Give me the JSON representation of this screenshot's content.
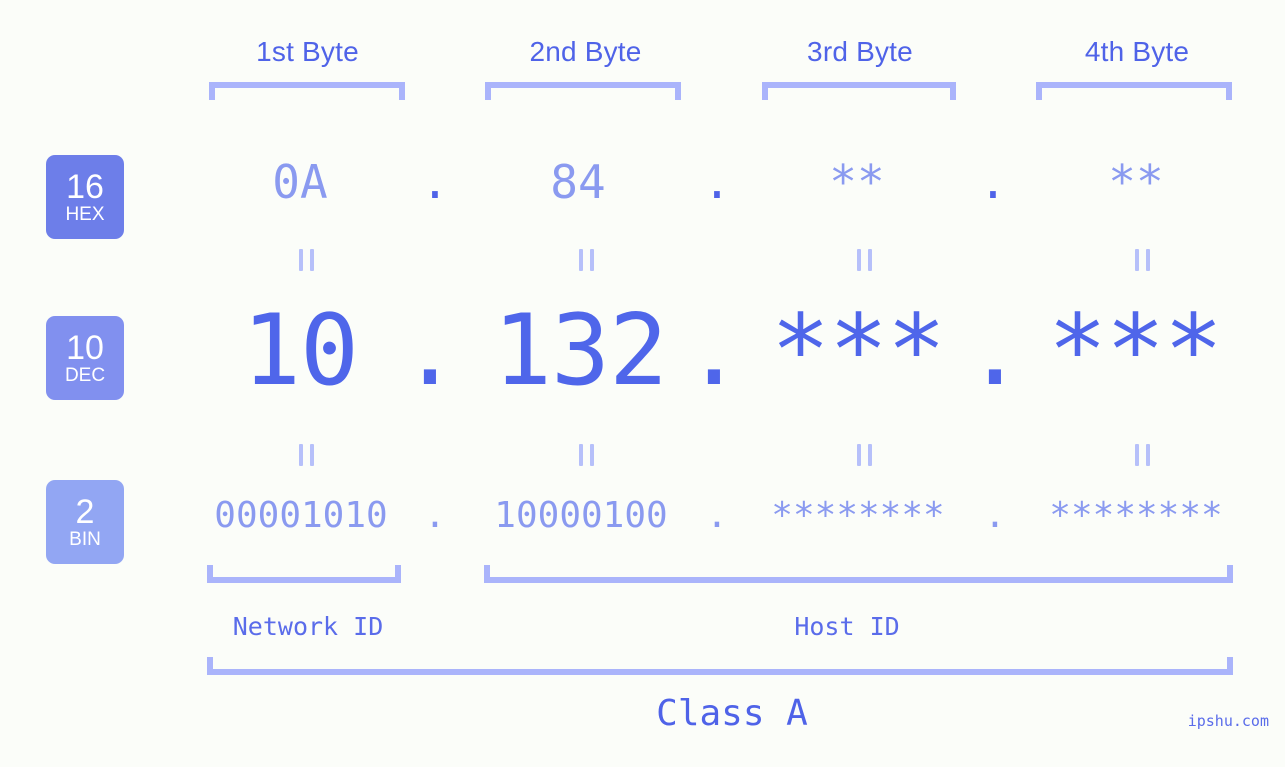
{
  "page": {
    "background_color": "#fbfdf9",
    "accent_color": "#4f63e8",
    "muted_accent_color": "#8a9af0",
    "bracket_color": "#aab4fb"
  },
  "byte_headers": [
    {
      "label": "1st Byte"
    },
    {
      "label": "2nd Byte"
    },
    {
      "label": "3rd Byte"
    },
    {
      "label": "4th Byte"
    }
  ],
  "bases": [
    {
      "number": "16",
      "abbr": "HEX",
      "color": "#6d7ee9"
    },
    {
      "number": "10",
      "abbr": "DEC",
      "color": "#8190ef"
    },
    {
      "number": "2",
      "abbr": "BIN",
      "color": "#92a6f3"
    }
  ],
  "rows": {
    "hex": {
      "base_number": "16",
      "base_abbr": "HEX",
      "values": [
        "0A",
        "84",
        "**",
        "**"
      ],
      "separator": "."
    },
    "dec": {
      "base_number": "10",
      "base_abbr": "DEC",
      "values": [
        "10",
        "132",
        "***",
        "***"
      ],
      "separator": "."
    },
    "bin": {
      "base_number": "2",
      "base_abbr": "BIN",
      "values": [
        "00001010",
        "10000100",
        "********",
        "********"
      ],
      "separator": "."
    }
  },
  "equality_marks": {
    "symbol": "=",
    "count_per_gap": 4
  },
  "segments": {
    "network_id": "Network ID",
    "host_id": "Host ID",
    "class": "Class A"
  },
  "watermark": "ipshu.com"
}
